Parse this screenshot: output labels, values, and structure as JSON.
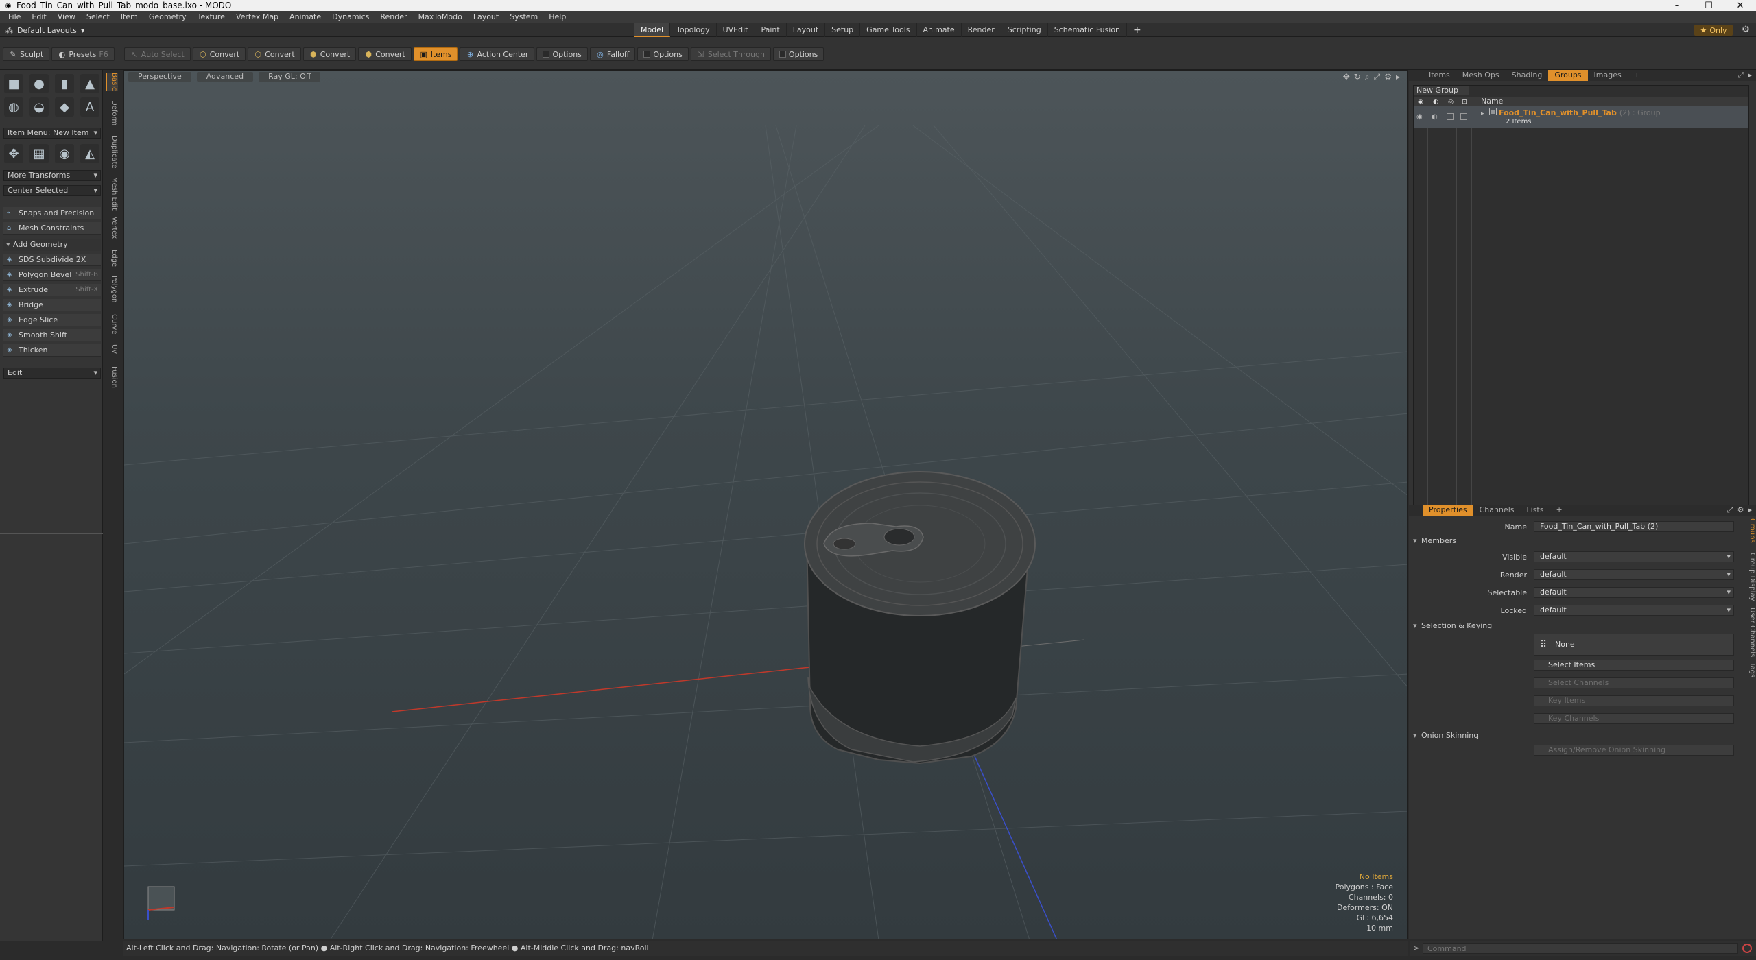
{
  "window": {
    "title": "Food_Tin_Can_with_Pull_Tab_modo_base.lxo - MODO",
    "minimize": "–",
    "maximize": "☐",
    "close": "✕"
  },
  "menu": [
    "File",
    "Edit",
    "View",
    "Select",
    "Item",
    "Geometry",
    "Texture",
    "Vertex Map",
    "Animate",
    "Dynamics",
    "Render",
    "MaxToModo",
    "Layout",
    "System",
    "Help"
  ],
  "layoutbar": {
    "layouts_label": "Default Layouts",
    "tabs": [
      "Model",
      "Topology",
      "UVEdit",
      "Paint",
      "Layout",
      "Setup",
      "Game Tools",
      "Animate",
      "Render",
      "Scripting",
      "Schematic Fusion"
    ],
    "active_tab": "Model",
    "add_tab": "+",
    "only_label": "Only"
  },
  "toolbar": {
    "sculpt": "Sculpt",
    "presets": "Presets",
    "presets_key": "F6",
    "auto_select": "Auto Select",
    "convert1": "Convert",
    "convert2": "Convert",
    "convert3": "Convert",
    "convert4": "Convert",
    "items": "Items",
    "action_center": "Action Center",
    "options1": "Options",
    "falloff": "Falloff",
    "options2": "Options",
    "select_through": "Select Through",
    "options3": "Options"
  },
  "leftpanel": {
    "item_menu": "Item Menu: New Item",
    "more_transforms": "More Transforms",
    "center_selected": "Center Selected",
    "snaps": "Snaps and Precision",
    "mesh_constraints": "Mesh Constraints",
    "add_geometry": "Add Geometry",
    "tools": [
      {
        "label": "SDS Subdivide 2X",
        "shortcut": ""
      },
      {
        "label": "Polygon Bevel",
        "shortcut": "Shift-B"
      },
      {
        "label": "Extrude",
        "shortcut": "Shift-X"
      },
      {
        "label": "Bridge",
        "shortcut": ""
      },
      {
        "label": "Edge Slice",
        "shortcut": ""
      },
      {
        "label": "Smooth Shift",
        "shortcut": ""
      },
      {
        "label": "Thicken",
        "shortcut": ""
      }
    ],
    "edit": "Edit",
    "vtabs": [
      "Basic",
      "Deform",
      "Duplicate",
      "Mesh Edit",
      "Vertex",
      "Edge",
      "Polygon",
      "Curve",
      "UV",
      "Fusion"
    ]
  },
  "viewport": {
    "perspective": "Perspective",
    "advanced": "Advanced",
    "raygl": "Ray GL: Off",
    "stats": {
      "items": "No Items",
      "polygons": "Polygons : Face",
      "channels": "Channels: 0",
      "deformers": "Deformers: ON",
      "gl": "GL: 6,654",
      "scale": "10 mm"
    }
  },
  "statusbar": {
    "text": "Alt-Left Click and Drag: Navigation: Rotate (or Pan) ● Alt-Right Click and Drag: Navigation: Freewheel ● Alt-Middle Click and Drag: navRoll"
  },
  "command": {
    "prompt": ">",
    "placeholder": "Command"
  },
  "rightpanel": {
    "top_tabs": [
      "Items",
      "Mesh Ops",
      "Shading",
      "Groups",
      "Images"
    ],
    "top_active": "Groups",
    "add": "+",
    "new_group": "New Group",
    "col_name": "Name",
    "group": {
      "name": "Food_Tin_Can_with_Pull_Tab",
      "type": "(2) : Group",
      "count": "2 Items"
    },
    "bottom_tabs": [
      "Properties",
      "Channels",
      "Lists"
    ],
    "bottom_active": "Properties",
    "props": {
      "name_label": "Name",
      "name_value": "Food_Tin_Can_with_Pull_Tab (2)",
      "members": "Members",
      "visible_label": "Visible",
      "visible_value": "default",
      "render_label": "Render",
      "render_value": "default",
      "selectable_label": "Selectable",
      "selectable_value": "default",
      "locked_label": "Locked",
      "locked_value": "default",
      "selection_keying": "Selection & Keying",
      "none": "None",
      "select_items": "Select Items",
      "select_channels": "Select Channels",
      "key_items": "Key Items",
      "key_channels": "Key Channels",
      "onion": "Onion Skinning",
      "assign_onion": "Assign/Remove Onion Skinning"
    },
    "side_vtabs": [
      "Groups",
      "Group Display",
      "User Channels",
      "Tags"
    ]
  },
  "colors": {
    "accent": "#e0902b",
    "axis_x": "#c0392b",
    "axis_z": "#3a4fc9"
  }
}
